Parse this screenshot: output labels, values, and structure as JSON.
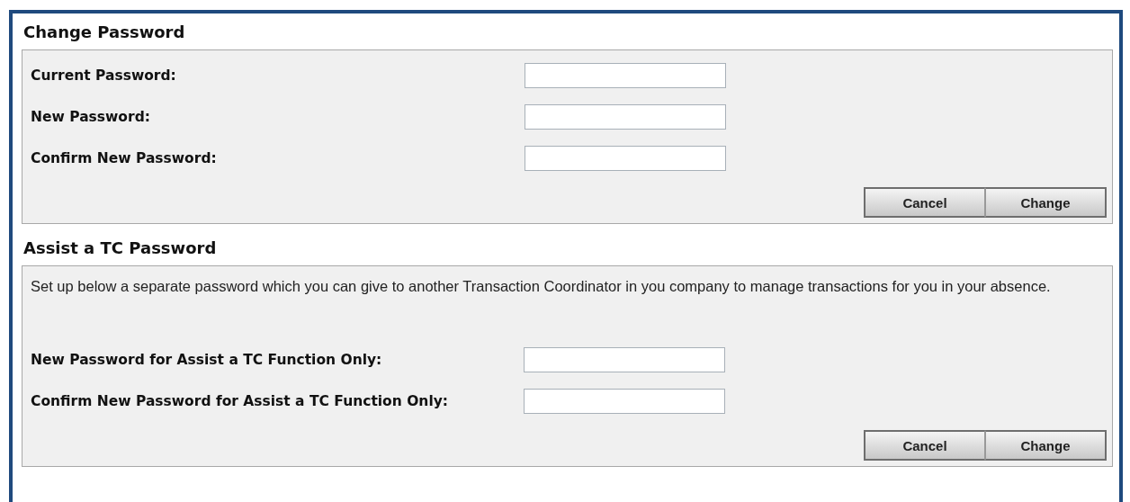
{
  "sections": [
    {
      "title": "Change Password",
      "fields": [
        {
          "label": "Current Password:"
        },
        {
          "label": "New Password:"
        },
        {
          "label": "Confirm New Password:"
        }
      ],
      "buttons": [
        "Cancel",
        "Change"
      ]
    },
    {
      "title": "Assist a TC Password",
      "description": "Set up below a separate password which you can give to another Transaction Coordinator in you company to manage transactions for you in your absence.",
      "fields": [
        {
          "label": "New Password for Assist a TC Function Only:"
        },
        {
          "label": "Confirm New Password for Assist a TC Function Only:"
        }
      ],
      "buttons": [
        "Cancel",
        "Change"
      ]
    }
  ]
}
